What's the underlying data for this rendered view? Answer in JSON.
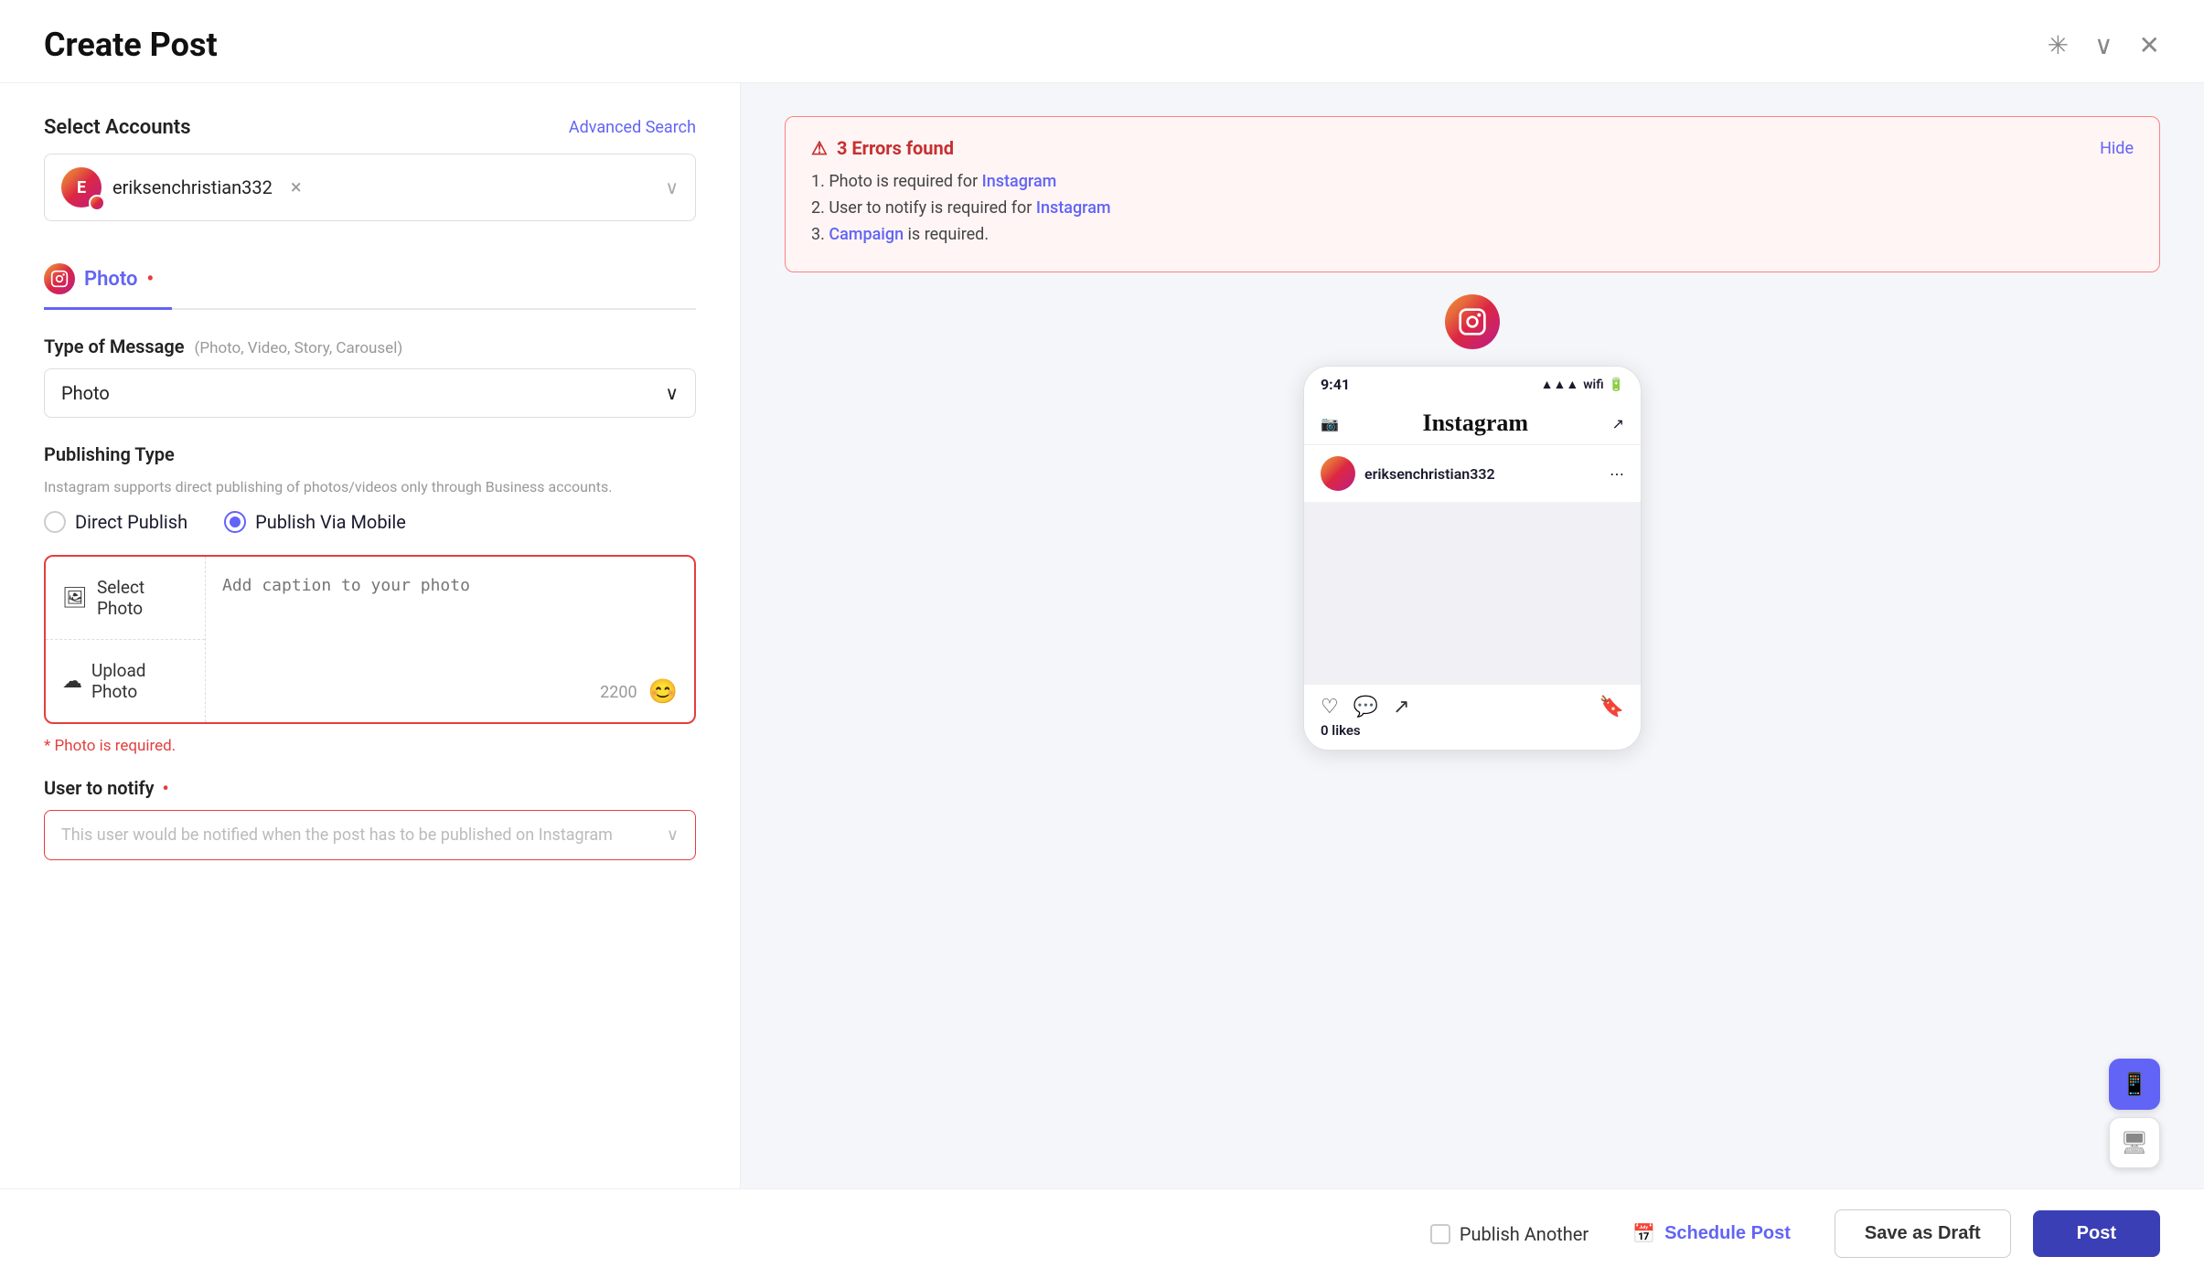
{
  "header": {
    "title": "Create Post",
    "pin_icon": "📌",
    "chevron_icon": "⌄",
    "close_icon": "✕"
  },
  "left_panel": {
    "select_accounts_label": "Select Accounts",
    "advanced_search_label": "Advanced Search",
    "account": {
      "name": "eriksenchristian332",
      "initials": "E"
    },
    "tabs": [
      {
        "id": "photo",
        "label": "Photo",
        "active": true,
        "required": true
      }
    ],
    "type_of_message": {
      "label": "Type of Message",
      "sublabel": "(Photo, Video, Story, Carousel)",
      "value": "Photo"
    },
    "publishing_type": {
      "label": "Publishing Type",
      "description": "Instagram supports direct publishing of photos/videos only through Business accounts.",
      "options": [
        {
          "id": "direct",
          "label": "Direct Publish",
          "selected": false
        },
        {
          "id": "mobile",
          "label": "Publish Via Mobile",
          "selected": true
        }
      ]
    },
    "upload": {
      "select_photo_label": "Select Photo",
      "upload_photo_label": "Upload Photo",
      "caption_placeholder": "Add caption to your photo",
      "char_count": "2200"
    },
    "photo_error": "* Photo is required.",
    "user_to_notify": {
      "label": "User to notify",
      "required": true,
      "placeholder": "This user would be notified when the post has to be published on Instagram"
    }
  },
  "right_panel": {
    "error_banner": {
      "title": "3 Errors found",
      "hide_label": "Hide",
      "errors": [
        {
          "text": "Photo is required for ",
          "link": "Instagram"
        },
        {
          "text": "User to notify is required for ",
          "link": "Instagram"
        },
        {
          "text": "",
          "link": "Campaign",
          "suffix": " is required."
        }
      ]
    },
    "preview": {
      "time": "9:41",
      "app_name": "Instagram",
      "username": "eriksenchristian332",
      "likes": "0 likes"
    }
  },
  "bottom_bar": {
    "publish_another_label": "Publish Another",
    "schedule_label": "Schedule Post",
    "save_draft_label": "Save as Draft",
    "post_label": "Post"
  }
}
